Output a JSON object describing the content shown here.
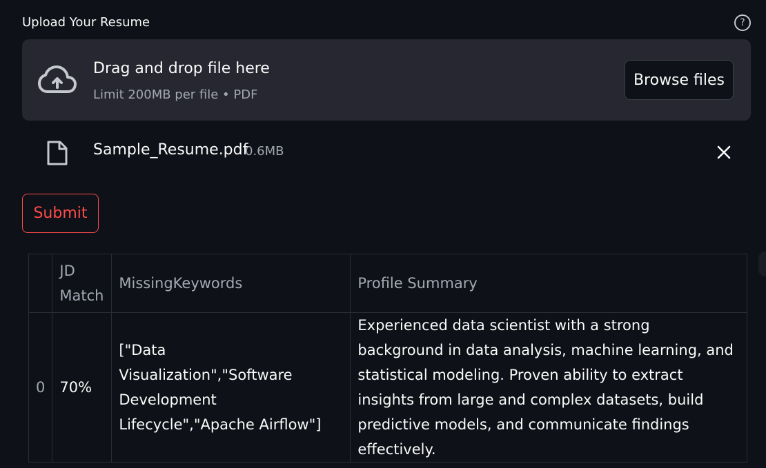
{
  "uploader": {
    "label": "Upload Your Resume",
    "help_icon": "question-circle-icon",
    "dropzone_title": "Drag and drop file here",
    "dropzone_limit": "Limit 200MB per file • PDF",
    "browse_label": "Browse files",
    "upload_icon": "cloud-upload-icon"
  },
  "file": {
    "icon": "file-icon",
    "name": "Sample_Resume.pdf",
    "size": "0.6MB",
    "remove_icon": "close-icon"
  },
  "submit": {
    "label": "Submit"
  },
  "table": {
    "headers": [
      "",
      "JD Match",
      "MissingKeywords",
      "Profile Summary"
    ],
    "rows": [
      {
        "index": "0",
        "jd_match": "70%",
        "missing_keywords": "[\"Data Visualization\",\"Software Development Lifecycle\",\"Apache Airflow\"]",
        "profile_summary": "Experienced data scientist with a strong background in data analysis, machine learning, and statistical modeling. Proven ability to extract insights from large and complex datasets, build predictive models, and communicate findings effectively."
      }
    ]
  },
  "colors": {
    "background": "#0e1117",
    "dropzone": "#262730",
    "accent": "#ff4b4b",
    "muted_text": "#a3a8b4"
  }
}
